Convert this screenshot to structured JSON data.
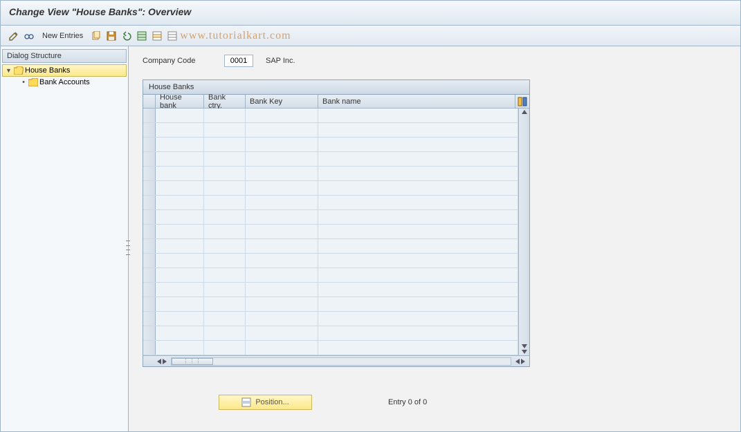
{
  "title": "Change View \"House Banks\": Overview",
  "toolbar": {
    "new_entries_label": "New Entries"
  },
  "watermark": "www.tutorialkart.com",
  "sidebar": {
    "header": "Dialog Structure",
    "items": [
      {
        "label": "House Banks"
      },
      {
        "label": "Bank Accounts"
      }
    ]
  },
  "company_code": {
    "label": "Company Code",
    "value": "0001",
    "description": "SAP Inc."
  },
  "table": {
    "title": "House Banks",
    "columns": {
      "house_bank": "House bank",
      "bank_ctry": "Bank ctry.",
      "bank_key": "Bank Key",
      "bank_name": "Bank name"
    }
  },
  "position_btn_label": "Position...",
  "entry_status": "Entry 0 of 0"
}
